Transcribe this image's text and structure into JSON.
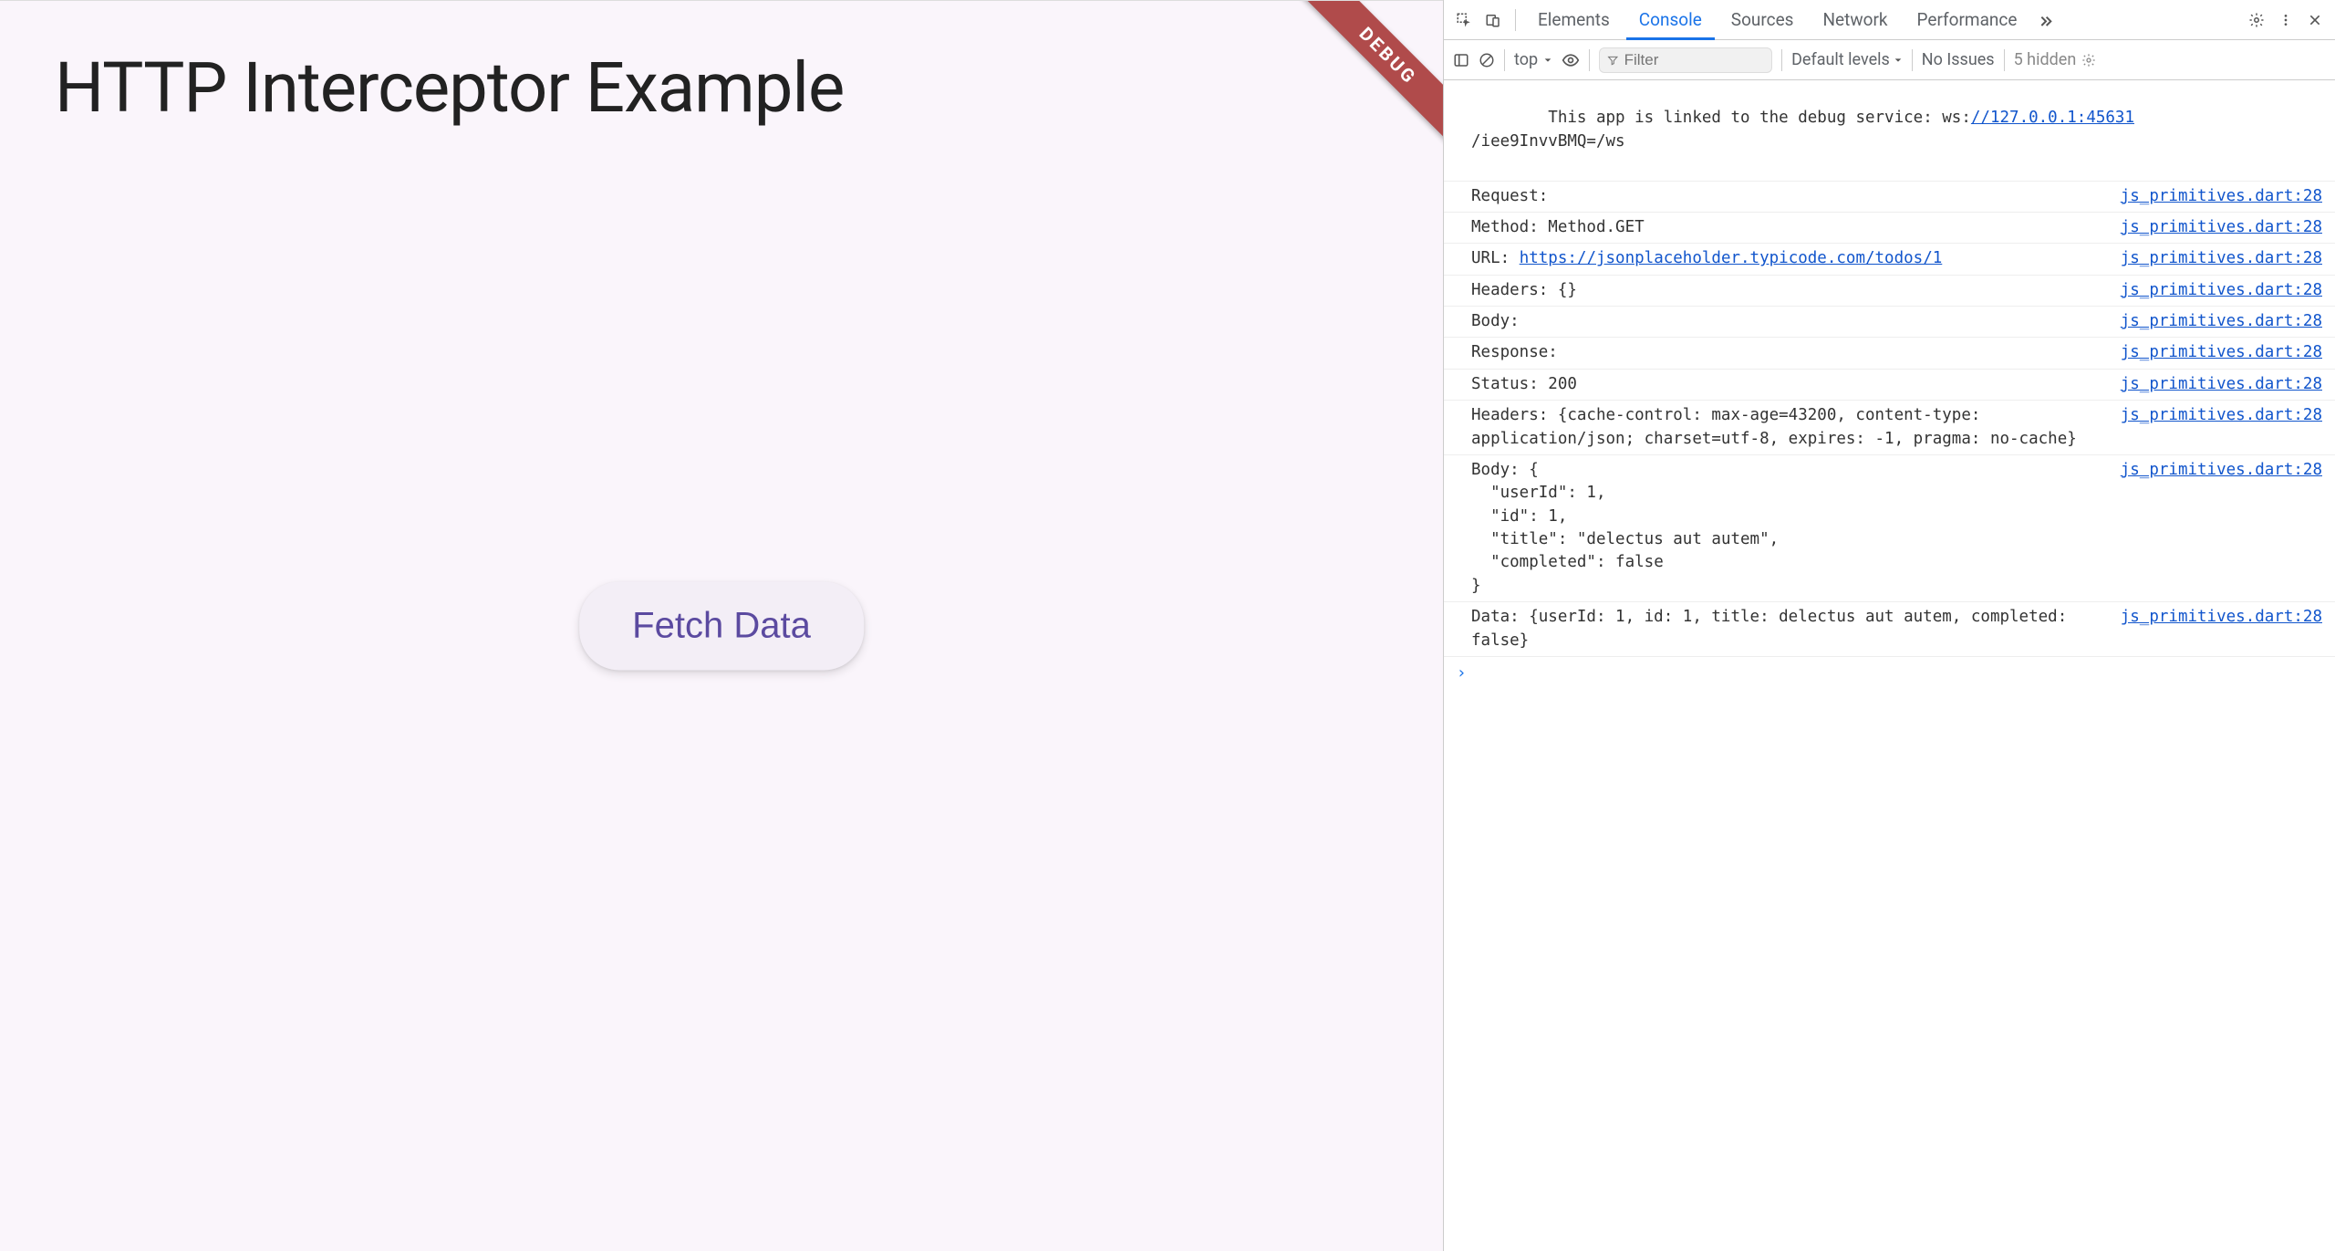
{
  "app": {
    "title": "HTTP Interceptor Example",
    "button_label": "Fetch Data",
    "debug_label": "DEBUG"
  },
  "devtools": {
    "tabs": [
      "Elements",
      "Console",
      "Sources",
      "Network",
      "Performance"
    ],
    "active_tab": "Console",
    "toolbar": {
      "context_label": "top",
      "filter_placeholder": "Filter",
      "levels_label": "Default levels",
      "issues_label": "No Issues",
      "hidden_label": "5 hidden"
    },
    "source_link": "js_primitives.dart:28",
    "debug_service_prefix": "This app is linked to the debug service: ws:",
    "debug_service_link": "//127.0.0.1:45631",
    "debug_service_suffix": "/iee9InvvBMQ=/ws",
    "logs": [
      {
        "text": "Request:"
      },
      {
        "text": "Method: Method.GET"
      },
      {
        "prefix": "URL: ",
        "link": "https://jsonplaceholder.typicode.com/todos/1"
      },
      {
        "text": "Headers: {}"
      },
      {
        "text": "Body:"
      },
      {
        "text": "Response:"
      },
      {
        "text": "Status: 200"
      },
      {
        "text": "Headers: {cache-control: max-age=43200, content-type: application/json; charset=utf-8, expires: -1, pragma: no-cache}"
      },
      {
        "text": "Body: {\n  \"userId\": 1,\n  \"id\": 1,\n  \"title\": \"delectus aut autem\",\n  \"completed\": false\n}"
      },
      {
        "text": "Data: {userId: 1, id: 1, title: delectus aut autem, completed: false}"
      }
    ]
  }
}
